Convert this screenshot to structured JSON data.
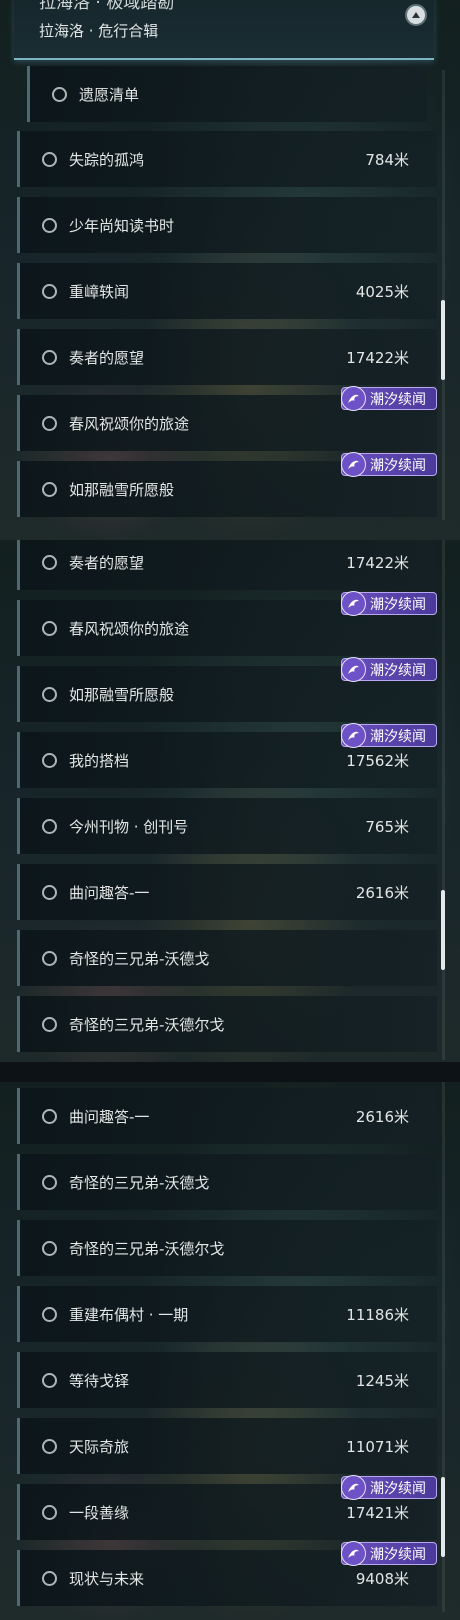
{
  "header": {
    "title": "拉海洛 · 极域踏勘",
    "subtitle": "拉海洛 · 危行合辑"
  },
  "badge_label": "潮汐续闻",
  "panel1": {
    "rows": [
      {
        "label": "遗愿清单",
        "distance": ""
      },
      {
        "label": "失踪的孤鸿",
        "distance": "784米"
      },
      {
        "label": "少年尚知读书时",
        "distance": ""
      },
      {
        "label": "重嶂轶闻",
        "distance": "4025米"
      },
      {
        "label": "奏者的愿望",
        "distance": "17422米"
      },
      {
        "label": "春风祝颂你的旅途",
        "distance": ""
      },
      {
        "label": "如那融雪所愿般",
        "distance": ""
      }
    ]
  },
  "panel2": {
    "rows": [
      {
        "label": "奏者的愿望",
        "distance": "17422米"
      },
      {
        "label": "春风祝颂你的旅途",
        "distance": ""
      },
      {
        "label": "如那融雪所愿般",
        "distance": ""
      },
      {
        "label": "我的搭档",
        "distance": "17562米"
      },
      {
        "label": "今州刊物 · 创刊号",
        "distance": "765米"
      },
      {
        "label": "曲问趣答-一",
        "distance": "2616米"
      },
      {
        "label": "奇怪的三兄弟-沃德戈",
        "distance": ""
      },
      {
        "label": "奇怪的三兄弟-沃德尔戈",
        "distance": ""
      }
    ]
  },
  "panel3": {
    "rows": [
      {
        "label": "曲问趣答-一",
        "distance": "2616米"
      },
      {
        "label": "奇怪的三兄弟-沃德戈",
        "distance": ""
      },
      {
        "label": "奇怪的三兄弟-沃德尔戈",
        "distance": ""
      },
      {
        "label": "重建布偶村 · 一期",
        "distance": "11186米"
      },
      {
        "label": "等待戈铎",
        "distance": "1245米"
      },
      {
        "label": "天际奇旅",
        "distance": "11071米"
      },
      {
        "label": "一段善缘",
        "distance": "17421米"
      },
      {
        "label": "现状与未来",
        "distance": "9408米"
      }
    ]
  },
  "icons": {
    "collapse": "chevron-up-icon",
    "radio": "radio-empty-icon",
    "badge": "tide-swirl-icon"
  },
  "colors": {
    "badge_bg": "#6a4fbf",
    "header_accent": "#7fb3c4",
    "row_edge": "#4d6a74"
  }
}
